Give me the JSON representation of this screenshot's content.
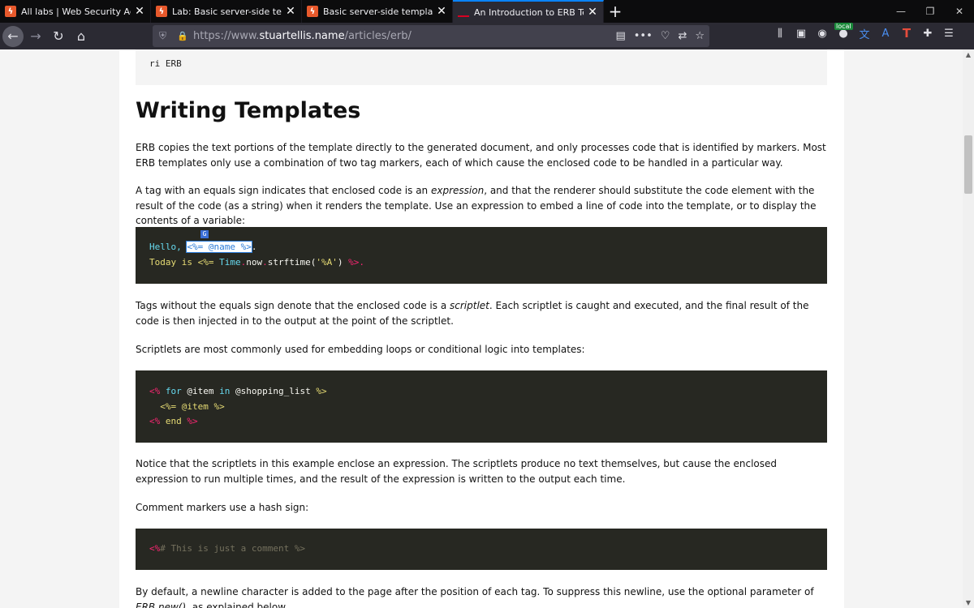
{
  "tabs": [
    {
      "label": "All labs | Web Security Academy",
      "active": false
    },
    {
      "label": "Lab: Basic server-side template injection",
      "active": false
    },
    {
      "label": "Basic server-side template injection",
      "active": false
    },
    {
      "label": "An Introduction to ERB Templating",
      "active": true
    }
  ],
  "url": {
    "prefix": "https://www.",
    "host": "stuartellis.name",
    "path": "/articles/erb/"
  },
  "toolbar": {
    "local_badge": "local",
    "t_icon": "T"
  },
  "page": {
    "top_code": "ri ERB",
    "heading": "Writing Templates",
    "p1": "ERB copies the text portions of the template directly to the generated document, and only processes code that is identified by markers. Most ERB templates only use a combination of two tag markers, each of which cause the enclosed code to be handled in a particular way.",
    "p2_a": "A tag with an equals sign indicates that enclosed code is an ",
    "p2_em": "expression",
    "p2_b": ", and that the renderer should substitute the code element with the result of the code (as a string) when it renders the template. Use an expression to embed a line of code into the template, or to display the contents of a variable:",
    "code1": {
      "l1_a": "Hello, ",
      "l1_sel": "<%= @name %>",
      "l1_b": ".",
      "l2_a": "Today is <%= ",
      "l2_time": "Time",
      "l2_dot1": ".",
      "l2_now": "now",
      "l2_dot2": ".",
      "l2_fn": "strftime(",
      "l2_str": "'%A'",
      "l2_close": ") ",
      "l2_end": "%>",
      "l2_tail": "."
    },
    "p3_a": "Tags without the equals sign denote that the enclosed code is a ",
    "p3_em": "scriptlet",
    "p3_b": ". Each scriptlet is caught and executed, and the final result of the code is then injected in to the output at the point of the scriptlet.",
    "p4": "Scriptlets are most commonly used for embedding loops or conditional logic into templates:",
    "code2": {
      "l1_open": "<%",
      "l1_for": " for ",
      "l1_var": " @item ",
      "l1_in": "in",
      "l1_list": " @shopping_list ",
      "l1_close": "%>",
      "l2": "  <%= @item %>",
      "l3_open": "<%",
      "l3_end": " end ",
      "l3_close": " %>"
    },
    "p5": "Notice that the scriptlets in this example enclose an expression. The scriptlets produce no text themselves, but cause the enclosed expression to run multiple times, and the result of the expression is written to the output each time.",
    "p6": "Comment markers use a hash sign:",
    "code3": {
      "open": "<%",
      "text": "# This is just a comment %>"
    },
    "p7_a": "By default, a newline character is added to the page after the position of each tag. To suppress this newline, use the optional parameter of ",
    "p7_em": "ERB.new()",
    "p7_b": ", as explained below."
  }
}
